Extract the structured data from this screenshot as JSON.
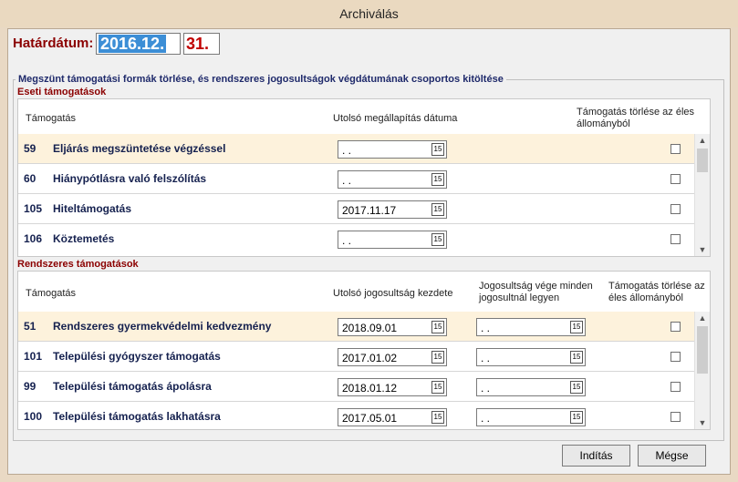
{
  "window": {
    "title": "Archiválás"
  },
  "hatardatum": {
    "label": "Határdátum:",
    "date_part1": "2016.12.",
    "date_part2": "31."
  },
  "group_title": "Megszünt támogatási formák törlése, és rendszeres jogosultságok végdátumának csoportos kitöltése",
  "eseti": {
    "title": "Eseti támogatások",
    "headers": {
      "tamogatas": "Támogatás",
      "utolso": "Utolsó megállapítás dátuma",
      "torles": "Támogatás törlése az éles állományból"
    },
    "rows": [
      {
        "code": "59",
        "name": "Eljárás megszüntetése végzéssel",
        "date": " .  .",
        "checked": false,
        "highlight": true
      },
      {
        "code": "60",
        "name": "Hiánypótlásra való felszólítás",
        "date": " .  .",
        "checked": false,
        "highlight": false
      },
      {
        "code": "105",
        "name": "Hiteltámogatás",
        "date": "2017.11.17",
        "checked": false,
        "highlight": false
      },
      {
        "code": "106",
        "name": "Köztemetés",
        "date": " .  .",
        "checked": false,
        "highlight": false
      }
    ]
  },
  "rendszeres": {
    "title": "Rendszeres támogatások",
    "headers": {
      "tamogatas": "Támogatás",
      "kezdete": "Utolsó jogosultság kezdete",
      "vege": "Jogosultság vége minden jogosultnál legyen",
      "torles": "Támogatás törlése az éles állományból"
    },
    "rows": [
      {
        "code": "51",
        "name": "Rendszeres gyermekvédelmi kedvezmény",
        "start": "2018.09.01",
        "end": " .  .",
        "checked": false,
        "highlight": true
      },
      {
        "code": "101",
        "name": "Települési gyógyszer támogatás",
        "start": "2017.01.02",
        "end": " .  .",
        "checked": false,
        "highlight": false
      },
      {
        "code": "99",
        "name": "Települési támogatás ápolásra",
        "start": "2018.01.12",
        "end": " .  .",
        "checked": false,
        "highlight": false
      },
      {
        "code": "100",
        "name": "Települési támogatás lakhatásra",
        "start": "2017.05.01",
        "end": " .  .",
        "checked": false,
        "highlight": false
      }
    ]
  },
  "calendar_glyph": "15",
  "buttons": {
    "inditas": "Indítás",
    "megse": "Mégse"
  },
  "colors": {
    "label_red": "#8b0000",
    "row_highlight": "#fdf2dc",
    "selection_blue": "#3c8ed6"
  }
}
